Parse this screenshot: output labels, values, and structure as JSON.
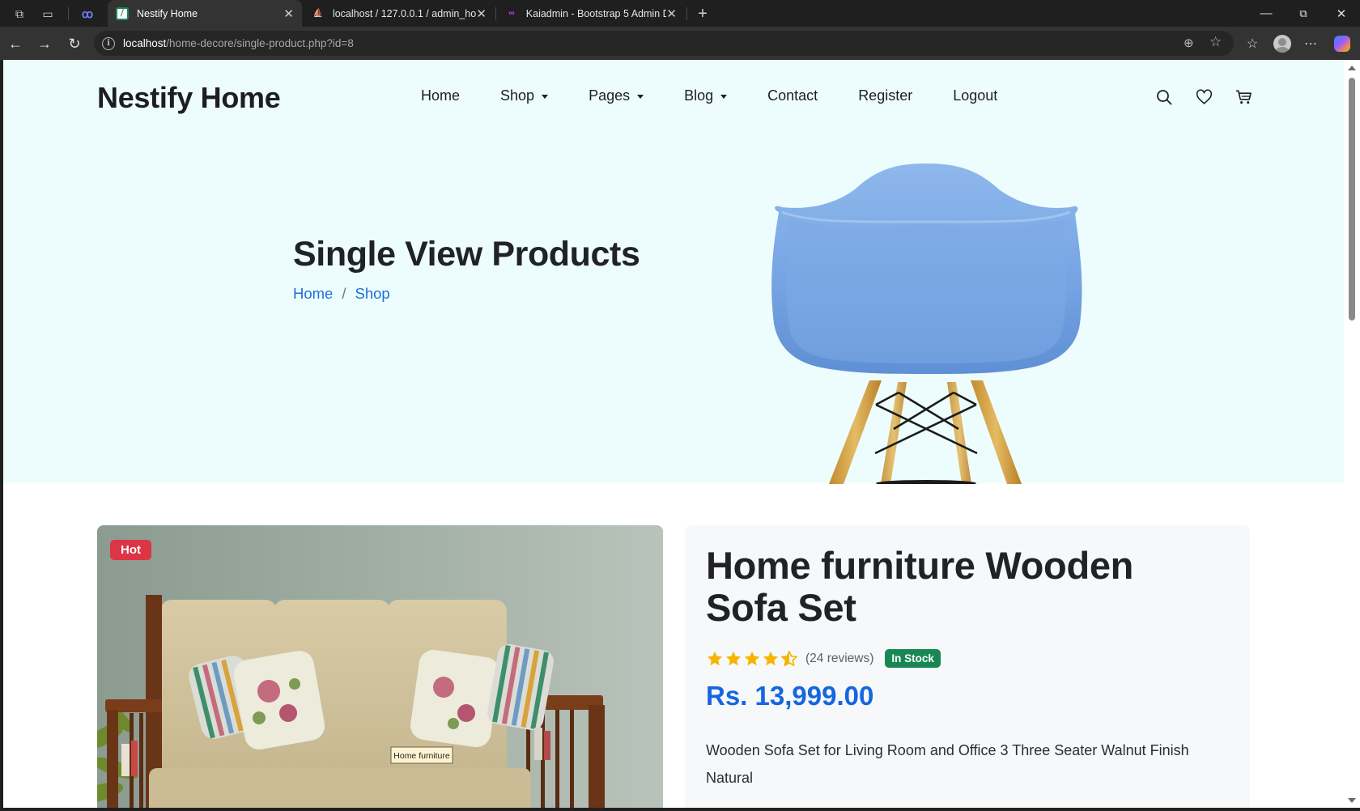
{
  "browser": {
    "tabs": [
      {
        "title": "Nestify Home",
        "active": true
      },
      {
        "title": "localhost / 127.0.0.1 / admin_hom",
        "active": false
      },
      {
        "title": "Kaiadmin - Bootstrap 5 Admin Da",
        "active": false
      }
    ],
    "url_host": "localhost",
    "url_path": "/home-decore/single-product.php?id=8"
  },
  "header": {
    "brand": "Nestify Home",
    "menu": [
      {
        "label": "Home",
        "dropdown": false
      },
      {
        "label": "Shop",
        "dropdown": true
      },
      {
        "label": "Pages",
        "dropdown": true
      },
      {
        "label": "Blog",
        "dropdown": true
      },
      {
        "label": "Contact",
        "dropdown": false
      },
      {
        "label": "Register",
        "dropdown": false
      },
      {
        "label": "Logout",
        "dropdown": false
      }
    ],
    "icons": [
      "search-icon",
      "heart-icon",
      "cart-icon"
    ]
  },
  "hero": {
    "title": "Single View Products",
    "breadcrumb": [
      {
        "label": "Home"
      },
      {
        "label": "Shop"
      }
    ],
    "separator": "/",
    "image": "blue-chair"
  },
  "product": {
    "badge": "Hot",
    "image_label": "Home furniture",
    "name": "Home furniture Wooden Sofa Set",
    "rating": 4.5,
    "rating_max": 5,
    "reviews": "(24 reviews)",
    "stock": "In Stock",
    "price": "Rs. 13,999.00",
    "description": "Wooden Sofa Set for Living Room and Office 3 Three Seater Walnut Finish Natural"
  },
  "colors": {
    "accent_blue": "#1566e0",
    "hero_bg": "#edfdfd",
    "badge_red": "#dc3545",
    "stock_green": "#198754",
    "star_gold": "#f5b400"
  }
}
